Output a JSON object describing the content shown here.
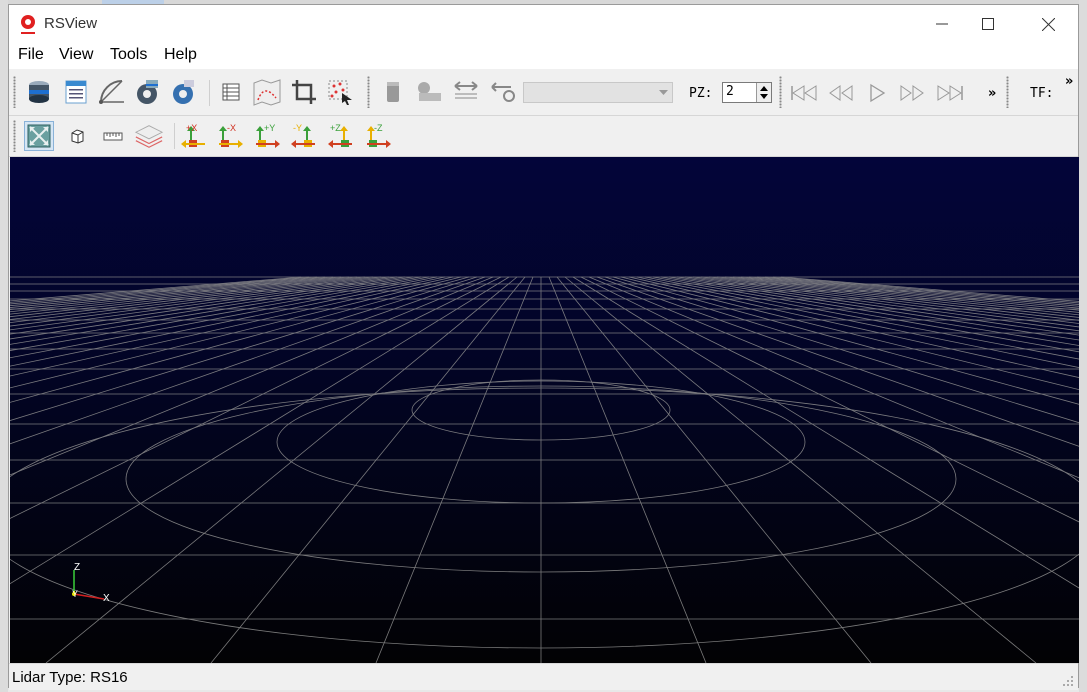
{
  "window": {
    "title": "RSView"
  },
  "menu": [
    "File",
    "View",
    "Tools",
    "Help"
  ],
  "toolbar": {
    "pz_label": "PZ:",
    "pz_value": "2",
    "tf_label": "TF:",
    "overflow_label": "»",
    "frame_select_value": ""
  },
  "toolbar2": {
    "view_pos_x": "+X",
    "view_neg_x": "-X",
    "view_pos_y": "+Y",
    "view_neg_y": "-Y",
    "view_pos_z": "+Z",
    "view_neg_z": "-Z"
  },
  "axes": {
    "z": "Z",
    "y": "Y",
    "x": "X"
  },
  "status": {
    "text": "Lidar Type: RS16"
  },
  "colors": {
    "sky_top": "#03053a",
    "ground_bottom": "#020204",
    "grid": "#8f8f8f"
  }
}
